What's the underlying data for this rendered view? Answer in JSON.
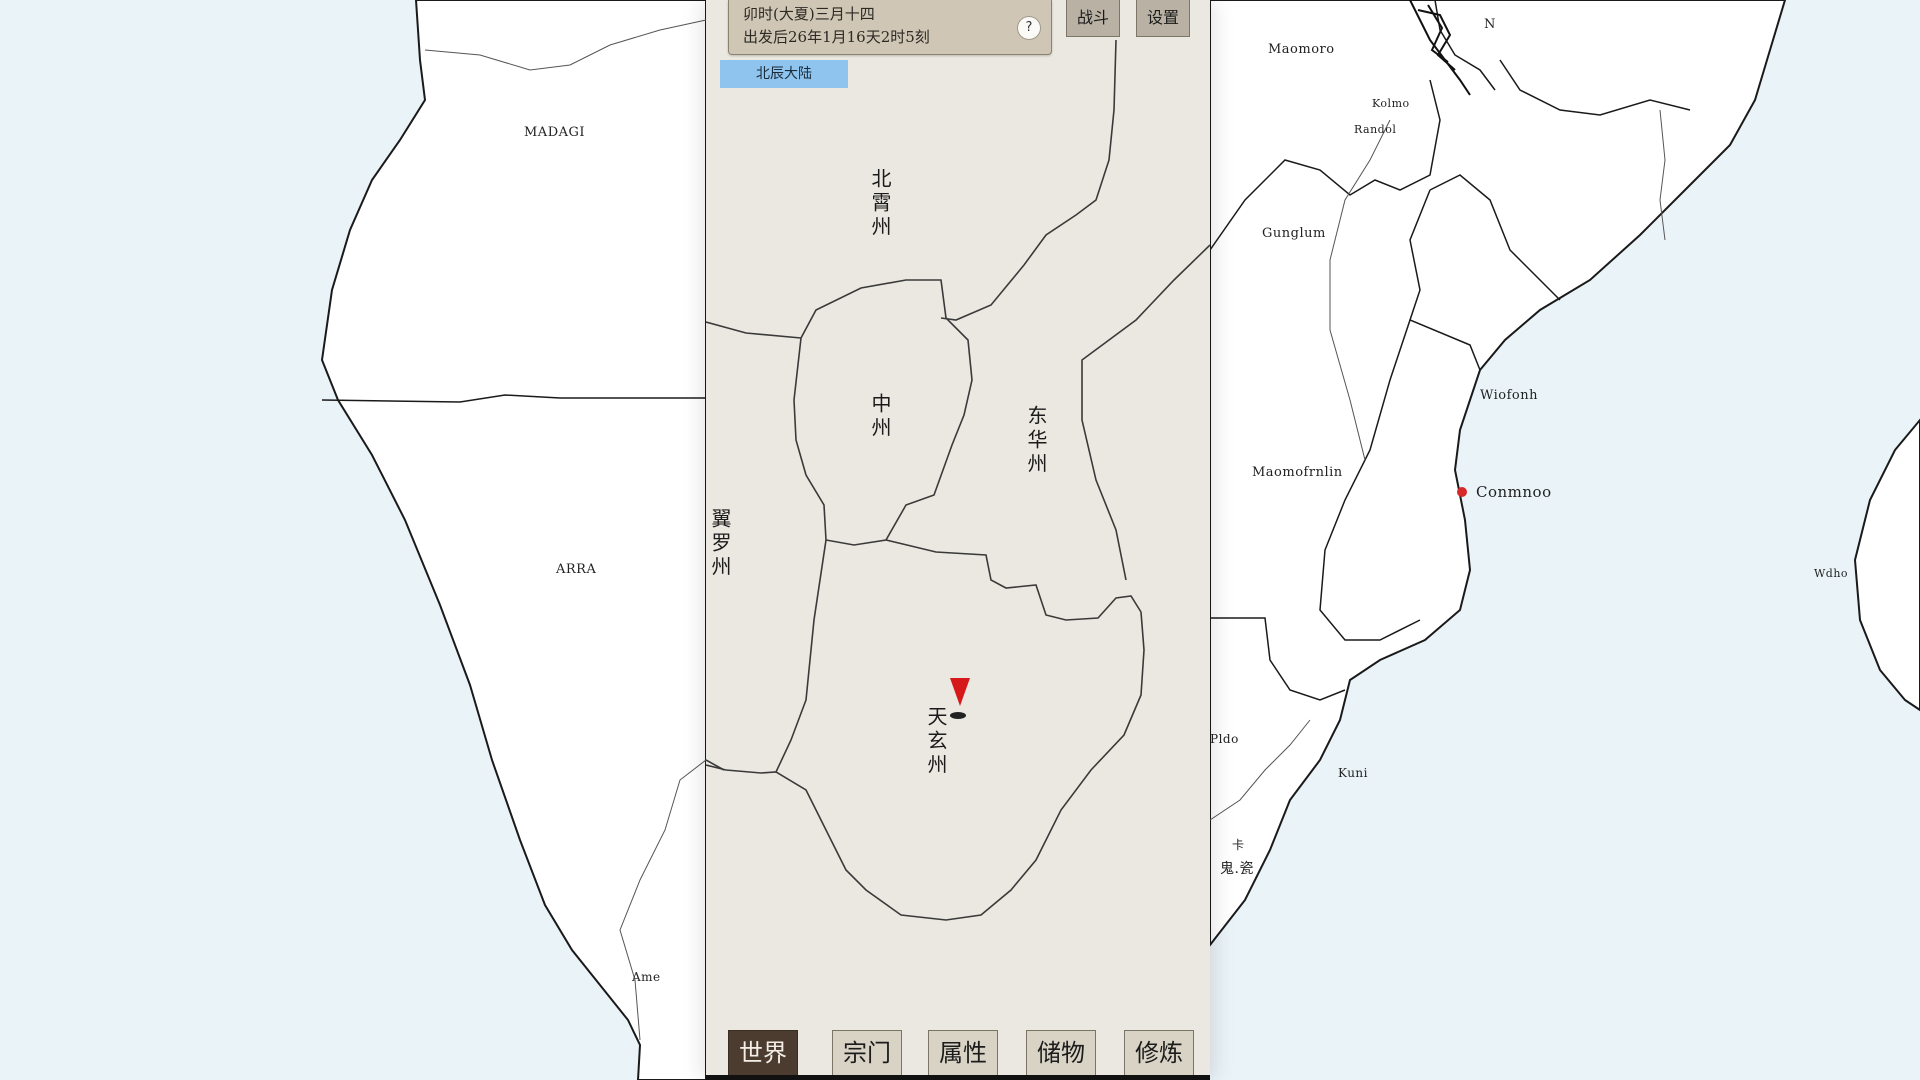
{
  "world_map": {
    "labels": [
      {
        "id": "nw",
        "text": "MADAGI"
      },
      {
        "id": "w",
        "text": "ARRA"
      },
      {
        "id": "ne-n",
        "text": "N"
      },
      {
        "id": "ne1",
        "text": "Maomoro"
      },
      {
        "id": "ne2",
        "text": "Kolmo"
      },
      {
        "id": "ne3",
        "text": "Randol"
      },
      {
        "id": "e1",
        "text": "Gunglum"
      },
      {
        "id": "e2",
        "text": "Wiofonh"
      },
      {
        "id": "e3",
        "text": "Maomofrnlin"
      },
      {
        "id": "e4",
        "text": "Wdho"
      },
      {
        "id": "se1",
        "text": "Pldo"
      },
      {
        "id": "se2",
        "text": "Kuni"
      },
      {
        "id": "se3",
        "text": "卡"
      },
      {
        "id": "se4",
        "text": "鬼.瓷"
      },
      {
        "id": "sw",
        "text": "Ame"
      }
    ],
    "city": {
      "name": "Conmnoo",
      "color": "#d62828"
    }
  },
  "panel": {
    "info": {
      "line1": "卯时(大夏)三月十四",
      "line2": "出发后26年1月16天2时5刻",
      "info_icon": "?"
    },
    "top_buttons": [
      "战斗",
      "设置"
    ],
    "region_tag": "北辰大陆",
    "states": [
      {
        "id": "north",
        "text": "北霄州"
      },
      {
        "id": "central",
        "text": "中州"
      },
      {
        "id": "east",
        "text": "东华州"
      },
      {
        "id": "west",
        "text": "翼罗州"
      },
      {
        "id": "south",
        "text": "天玄州"
      }
    ],
    "nav_tabs": [
      {
        "label": "世界",
        "active": true
      },
      {
        "label": "宗门",
        "active": false
      },
      {
        "label": "属性",
        "active": false
      },
      {
        "label": "储物",
        "active": false
      },
      {
        "label": "修炼",
        "active": false
      }
    ]
  },
  "colors": {
    "ocean": "#eaf3f8",
    "land": "#ffffff",
    "panel": "#ebe8e1",
    "tag": "#8fc4ee",
    "marker": "#d61a1a",
    "active_tab": "#4c3c30"
  }
}
